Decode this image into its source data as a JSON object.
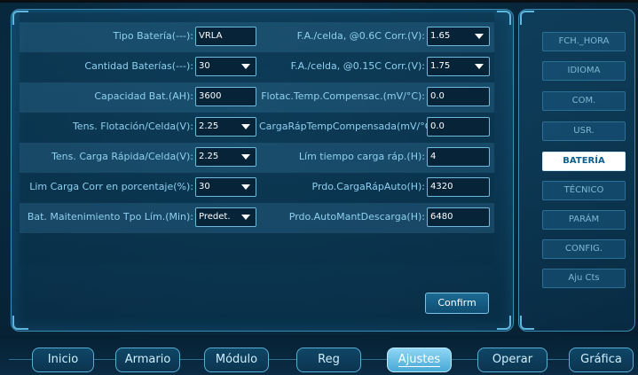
{
  "settings": {
    "left_rows": [
      {
        "label": "Tipo Batería(---):",
        "value": "VRLA",
        "dropdown": false
      },
      {
        "label": "Cantidad Baterías(---):",
        "value": "30",
        "dropdown": true
      },
      {
        "label": "Capacidad Bat.(AH):",
        "value": "3600",
        "dropdown": false
      },
      {
        "label": "Tens. Flotación/Celda(V):",
        "value": "2.25",
        "dropdown": true
      },
      {
        "label": "Tens. Carga Rápida/Celda(V):",
        "value": "2.25",
        "dropdown": true
      },
      {
        "label": "Lim Carga Corr en porcentaje(%):",
        "value": "30",
        "dropdown": true
      },
      {
        "label": "Bat. Maitenimiento Tpo Lím.(Min):",
        "value": "Predet.",
        "dropdown": true
      }
    ],
    "right_rows": [
      {
        "label": "F.A./celda, @0.6C Corr.(V):",
        "value": "1.65",
        "dropdown": true
      },
      {
        "label": "F.A./celda, @0.15C Corr.(V):",
        "value": "1.75",
        "dropdown": true
      },
      {
        "label": "Flotac.Temp.Compensac.(mV/°C):",
        "value": "0.0",
        "dropdown": false
      },
      {
        "label": "CargaRápTempCompensada(mV/°C):",
        "value": "0.0",
        "dropdown": false
      },
      {
        "label": "Lím tiempo carga ráp.(H):",
        "value": "4",
        "dropdown": false
      },
      {
        "label": "Prdo.CargaRápAuto(H):",
        "value": "4320",
        "dropdown": false
      },
      {
        "label": "Prdo.AutoMantDescarga(H):",
        "value": "6480",
        "dropdown": false
      }
    ],
    "confirm_label": "Confirm"
  },
  "side_menu": {
    "items": [
      "FCH._HORA",
      "IDIOMA",
      "COM.",
      "USR.",
      "BATERÍA",
      "TÉCNICO",
      "PARÁM",
      "CONFIG.",
      "Aju Cts"
    ],
    "active": "BATERÍA"
  },
  "bottom_nav": {
    "items": [
      "Inicio",
      "Armario",
      "Módulo",
      "Reg",
      "Ajustes",
      "Operar",
      "Gráfica"
    ],
    "active": "Ajustes"
  },
  "colors": {
    "background": "#082a40",
    "accent": "#5aaed6",
    "active_side": "#ffffff",
    "active_nav": "#47a9d6"
  }
}
